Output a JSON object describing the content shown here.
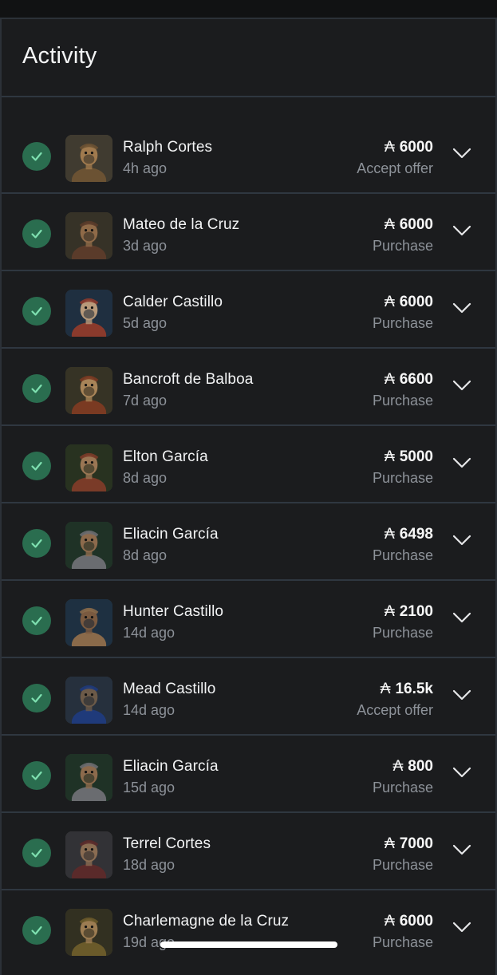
{
  "header": {
    "title": "Activity"
  },
  "currency_symbol": "₳",
  "colors": {
    "background": "#1b1c1e",
    "divider": "#2f3740",
    "check_bg": "#2a6d4f",
    "check_mark": "#7ee0b0",
    "secondary_text": "#8d9299"
  },
  "icons": {
    "status": "check-circle-icon",
    "expand": "chevron-down-icon"
  },
  "activities": [
    {
      "name": "Ralph Cortes",
      "time": "4h ago",
      "amount": "6000",
      "type": "Accept offer"
    },
    {
      "name": "Mateo de la Cruz",
      "time": "3d ago",
      "amount": "6000",
      "type": "Purchase"
    },
    {
      "name": "Calder Castillo",
      "time": "5d ago",
      "amount": "6000",
      "type": "Purchase"
    },
    {
      "name": "Bancroft de Balboa",
      "time": "7d ago",
      "amount": "6600",
      "type": "Purchase"
    },
    {
      "name": "Elton García",
      "time": "8d ago",
      "amount": "5000",
      "type": "Purchase"
    },
    {
      "name": "Eliacin García",
      "time": "8d ago",
      "amount": "6498",
      "type": "Purchase"
    },
    {
      "name": "Hunter Castillo",
      "time": "14d ago",
      "amount": "2100",
      "type": "Purchase"
    },
    {
      "name": "Mead Castillo",
      "time": "14d ago",
      "amount": "16.5k",
      "type": "Accept offer"
    },
    {
      "name": "Eliacin García",
      "time": "15d ago",
      "amount": "800",
      "type": "Purchase"
    },
    {
      "name": "Terrel Cortes",
      "time": "18d ago",
      "amount": "7000",
      "type": "Purchase"
    },
    {
      "name": "Charlemagne de la Cruz",
      "time": "19d ago",
      "amount": "6000",
      "type": "Purchase"
    }
  ]
}
